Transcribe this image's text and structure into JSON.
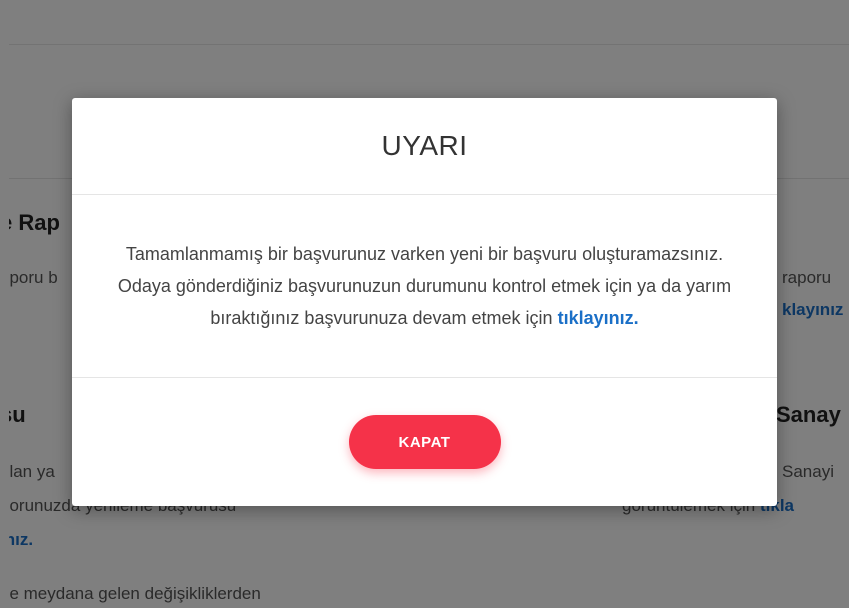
{
  "background": {
    "left_card_heading": "e Rap",
    "left_card_text": "eporu b",
    "right_card_text": "raporu",
    "right_card_link": "klayınız",
    "left_section_heading": "su",
    "left_section_line1": "olan ya",
    "left_section_line2": "porunuzda yenileme başvurusu",
    "left_section_link": "ınız.",
    "right_section_heading": "Sanay",
    "right_section_line1": "Sanayi",
    "right_section_line2": "görüntülemek için",
    "right_section_link": "tıkla",
    "bottom_text": "de meydana gelen değişikliklerden"
  },
  "modal": {
    "title": "UYARI",
    "message": "Tamamlanmamış bir başvurunuz varken yeni bir başvuru oluşturamazsınız. Odaya gönderdiğiniz başvurunuzun durumunu kontrol etmek için ya da yarım bıraktığınız başvurunuza devam etmek için",
    "link_text": "tıklayınız.",
    "close_label": "KAPAT"
  },
  "colors": {
    "accent_button": "#f53249",
    "link": "#1a6fc7",
    "overlay": "rgba(0,0,0,0.5)"
  }
}
